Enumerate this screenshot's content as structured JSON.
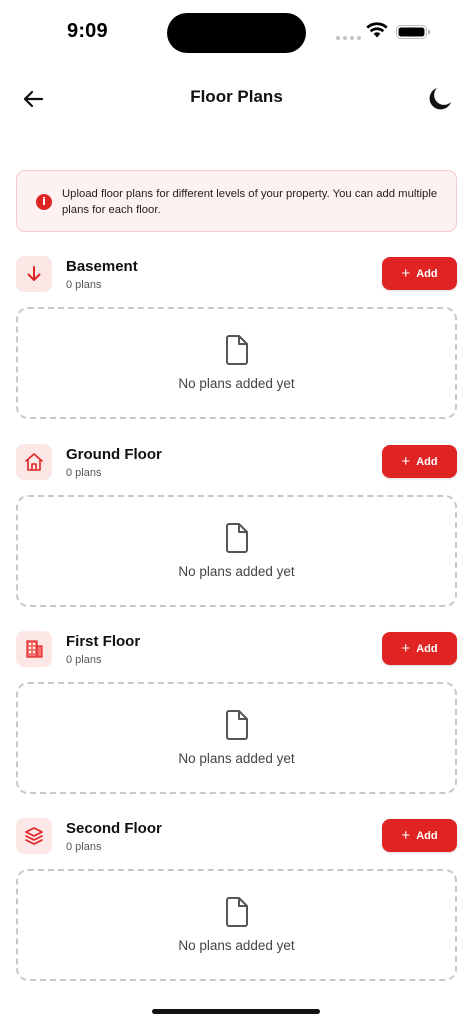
{
  "status_bar": {
    "time": "9:09"
  },
  "header": {
    "title": "Floor Plans"
  },
  "info": {
    "text": "Upload floor plans for different levels of your property. You can add multiple plans for each floor."
  },
  "colors": {
    "accent": "#e02424",
    "accent_light": "#fde6e6",
    "banner_bg": "#fdf1f1"
  },
  "floors": [
    {
      "name": "Basement",
      "count": "0 plans",
      "icon": "arrow-down-icon",
      "add_label": "Add",
      "empty_text": "No plans added yet"
    },
    {
      "name": "Ground Floor",
      "count": "0 plans",
      "icon": "house-icon",
      "add_label": "Add",
      "empty_text": "No plans added yet"
    },
    {
      "name": "First Floor",
      "count": "0 plans",
      "icon": "building-icon",
      "add_label": "Add",
      "empty_text": "No plans added yet"
    },
    {
      "name": "Second Floor",
      "count": "0 plans",
      "icon": "layers-icon",
      "add_label": "Add",
      "empty_text": "No plans added yet"
    }
  ]
}
